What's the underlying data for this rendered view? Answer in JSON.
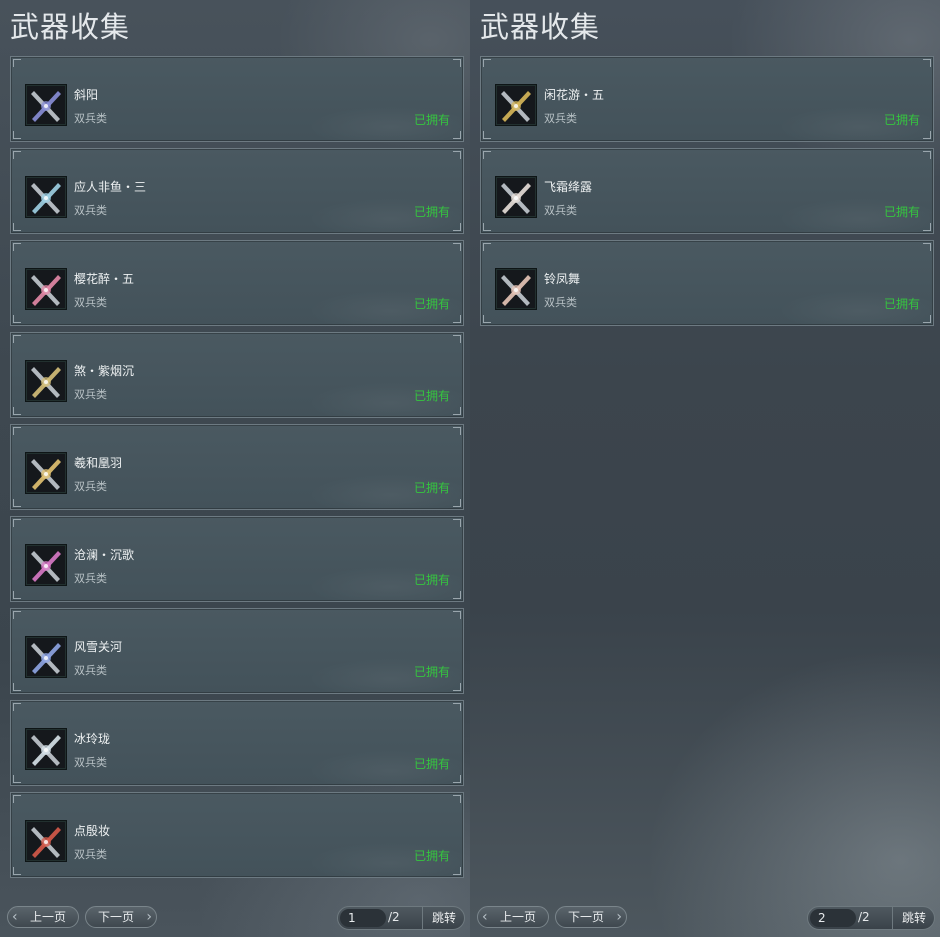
{
  "panels": [
    {
      "title": "武器收集",
      "items": [
        {
          "name": "斜阳",
          "type": "双兵类",
          "status": "已拥有",
          "icon": "weapon-icon-xieyang",
          "accent": "#8a8fd8"
        },
        {
          "name": "应人非鱼・三",
          "type": "双兵类",
          "status": "已拥有",
          "icon": "weapon-icon-yingrenfeiyu",
          "accent": "#9fd2e6"
        },
        {
          "name": "樱花醉・五",
          "type": "双兵类",
          "status": "已拥有",
          "icon": "weapon-icon-yinghuazui",
          "accent": "#e58aa8"
        },
        {
          "name": "煞・紫烟沉",
          "type": "双兵类",
          "status": "已拥有",
          "icon": "weapon-icon-ziyanchen",
          "accent": "#d6c07a"
        },
        {
          "name": "羲和凰羽",
          "type": "双兵类",
          "status": "已拥有",
          "icon": "weapon-icon-xihehuangyu",
          "accent": "#e3c372"
        },
        {
          "name": "沧澜・沉歌",
          "type": "双兵类",
          "status": "已拥有",
          "icon": "weapon-icon-canglan",
          "accent": "#d97ac8"
        },
        {
          "name": "风雪关河",
          "type": "双兵类",
          "status": "已拥有",
          "icon": "weapon-icon-fengxue",
          "accent": "#8fa6e6"
        },
        {
          "name": "冰玲珑",
          "type": "双兵类",
          "status": "已拥有",
          "icon": "weapon-icon-binglinglong",
          "accent": "#d7e3ea"
        },
        {
          "name": "点殷妆",
          "type": "双兵类",
          "status": "已拥有",
          "icon": "weapon-icon-dianyinzhuang",
          "accent": "#d65a4a"
        }
      ],
      "pagination": {
        "prev_label": "上一页",
        "next_label": "下一页",
        "current_page": "1",
        "total": "/2",
        "jump_label": "跳转"
      }
    },
    {
      "title": "武器收集",
      "items": [
        {
          "name": "闲花游・五",
          "type": "双兵类",
          "status": "已拥有",
          "icon": "weapon-icon-xianhuayou",
          "accent": "#d8b85a"
        },
        {
          "name": "飞霜绛露",
          "type": "双兵类",
          "status": "已拥有",
          "icon": "weapon-icon-feishuang",
          "accent": "#e8e0da"
        },
        {
          "name": "铃凤舞",
          "type": "双兵类",
          "status": "已拥有",
          "icon": "weapon-icon-lingfengwu",
          "accent": "#e8c6b8"
        }
      ],
      "pagination": {
        "prev_label": "上一页",
        "next_label": "下一页",
        "current_page": "2",
        "total": "/2",
        "jump_label": "跳转"
      }
    }
  ],
  "colors": {
    "owned_status": "#35c53f",
    "title": "#e4e8eb"
  }
}
